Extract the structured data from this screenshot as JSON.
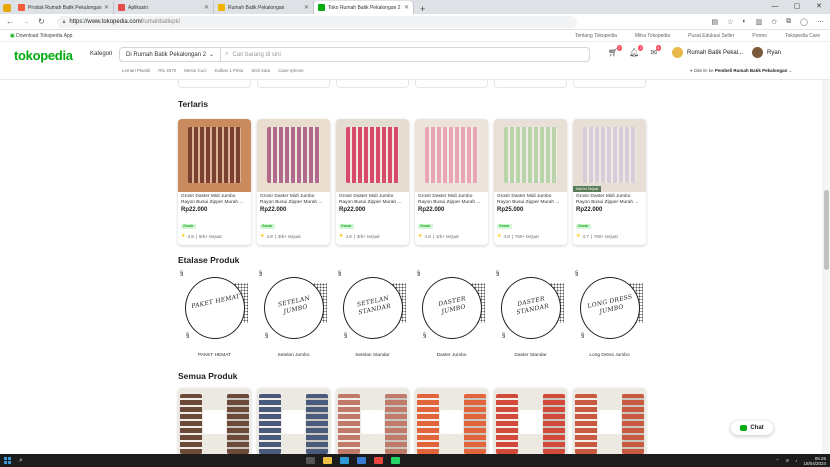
{
  "browser": {
    "tabs": [
      {
        "label": "Produk Rumah Batik Pekalongan",
        "color": "#f25c3b",
        "active": false
      },
      {
        "label": "Aplikasin",
        "color": "#e54b4b",
        "active": false
      },
      {
        "label": "Rumah Batik Pekalongan",
        "color": "#f0b400",
        "active": false
      },
      {
        "label": "Toko Rumah Batik Pekalongan 2",
        "color": "#03ac0e",
        "active": true
      }
    ],
    "url_host": "https://www.tokopedia.com/",
    "url_path": "rumahbatikpkl",
    "bookmark": "Download Tokopedia App",
    "top_links": [
      "Tentang Tokopedia",
      "Mitra Tokopedia",
      "Pusat Edukasi Seller",
      "Promo",
      "Tokopedia Care"
    ]
  },
  "header": {
    "logo": "tokopedia",
    "kategori": "Kategori",
    "search_scope": "Di Rumah Batik Pekalongan 2",
    "search_placeholder": "Cari barang di sini",
    "cart_count": "2",
    "notif_count": "2",
    "inbox_count": "4",
    "shop_name": "Rumah Batik Pekal...",
    "user_name": "Ryan",
    "quick_links": [
      "Lemari Plastik",
      "Rtx 4070",
      "Mesin Cuci",
      "Kulkas 1 Pintu",
      "Sisil Sata",
      "Case Iphone"
    ],
    "location_prefix": "Dikirim ke",
    "location_value": "Pembeli Rumah Batik Pekalongan"
  },
  "terlaris": {
    "title": "Terlaris",
    "products": [
      {
        "title": "Grosir Daster Midi Jumbo Rayon Busui Zipper Murah ...",
        "price": "Rp22.000",
        "badge": "Grosir",
        "rating": "4.9",
        "sold": "5rb+ terjual",
        "bg": "#c98a5e",
        "frame": "#7a4030",
        "tag": ""
      },
      {
        "title": "Grosir Daster Midi Jumbo Rayon Busui Zipper Murah ...",
        "price": "Rp22.000",
        "badge": "Grosir",
        "rating": "4.8",
        "sold": "3rb+ terjual",
        "bg": "#e9ddd0",
        "frame": "#b06a8a",
        "tag": ""
      },
      {
        "title": "Grosir Daster Midi Jumbo Rayon Busui Zipper Murah ...",
        "price": "Rp22.000",
        "badge": "Grosir",
        "rating": "4.8",
        "sold": "3rb+ terjual",
        "bg": "#e6ddd2",
        "frame": "#d74a6a",
        "tag": ""
      },
      {
        "title": "Grosir Daster Midi Jumbo Rayon Busui Zipper Murah ...",
        "price": "Rp22.000",
        "badge": "Grosir",
        "rating": "4.8",
        "sold": "1rb+ terjual",
        "bg": "#ece4da",
        "frame": "#e8a6b4",
        "tag": ""
      },
      {
        "title": "Grosir Daster Midi Jumbo Rayon Busui Zipper Murah ...",
        "price": "Rp25.000",
        "badge": "Grosir",
        "rating": "4.8",
        "sold": "750+ terjual",
        "bg": "#e8e0d6",
        "frame": "#b8d4a8",
        "tag": ""
      },
      {
        "title": "Grosir Daster Midi Jumbo Rayon Busui Zipper Murah ...",
        "price": "Rp22.000",
        "badge": "Grosir",
        "rating": "4.7",
        "sold": "750+ terjual",
        "bg": "#e7dfd5",
        "frame": "#d8ccd8",
        "tag": "Hari ini Terjual"
      }
    ]
  },
  "etalase": {
    "title": "Etalase Produk",
    "items": [
      {
        "label_img": "PAKET HEMAT",
        "name": "PAKET HEMAT"
      },
      {
        "label_img": "SETELAN JUMBO",
        "name": "Setelan Jumbo"
      },
      {
        "label_img": "SETELAN STANDAR",
        "name": "Setelan Standar"
      },
      {
        "label_img": "DASTER JUMBO",
        "name": "Daster Jumbo"
      },
      {
        "label_img": "DASTER STANDAR",
        "name": "Daster Standar"
      },
      {
        "label_img": "LONG DRESS JUMBO",
        "name": "Long Dress Jumbo"
      }
    ]
  },
  "semua": {
    "title": "Semua Produk",
    "thumbs": [
      "#6b4a3a",
      "#4a5a7a",
      "#c07a6a",
      "#e2643a",
      "#d24a3a",
      "#c85a40"
    ]
  },
  "chat": {
    "label": "Chat"
  },
  "taskbar": {
    "time": "09.26",
    "date": "18/04/2024"
  },
  "colors": {
    "brand": "#03ac0e",
    "badge_red": "#f94d63"
  }
}
